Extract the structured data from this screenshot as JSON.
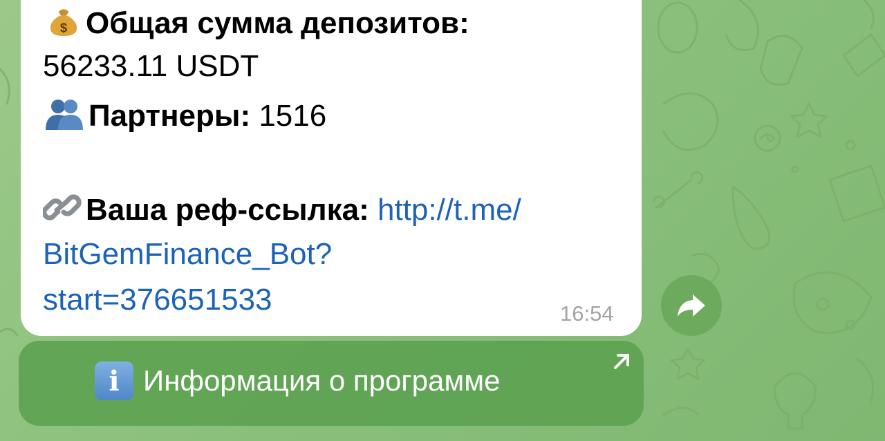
{
  "message": {
    "deposits_emoji": "money-bag-icon",
    "deposits_label": "Общая сумма депозитов:",
    "deposits_value": "56233.11 USDT",
    "partners_emoji": "busts-icon",
    "partners_label": "Партнеры:",
    "partners_value": "1516",
    "ref_emoji": "link-icon",
    "ref_label": "Ваша реф-ссылка:",
    "ref_link_part1": "http://t.me/",
    "ref_link_part2": "BitGemFinance_Bot?",
    "ref_link_part3": "start=376651533",
    "time": "16:54"
  },
  "share_button": {
    "icon": "share-arrow-icon"
  },
  "inline_button": {
    "icon": "info-icon",
    "icon_glyph": "i",
    "label": "Информация о программе",
    "corner_icon": "external-arrow-icon"
  },
  "colors": {
    "background": "#8fc27f",
    "bubble": "#ffffff",
    "link": "#1c63b7",
    "time": "#a3a3a3",
    "share_button": "#6daa5e",
    "inline_button": "#5ba050"
  }
}
